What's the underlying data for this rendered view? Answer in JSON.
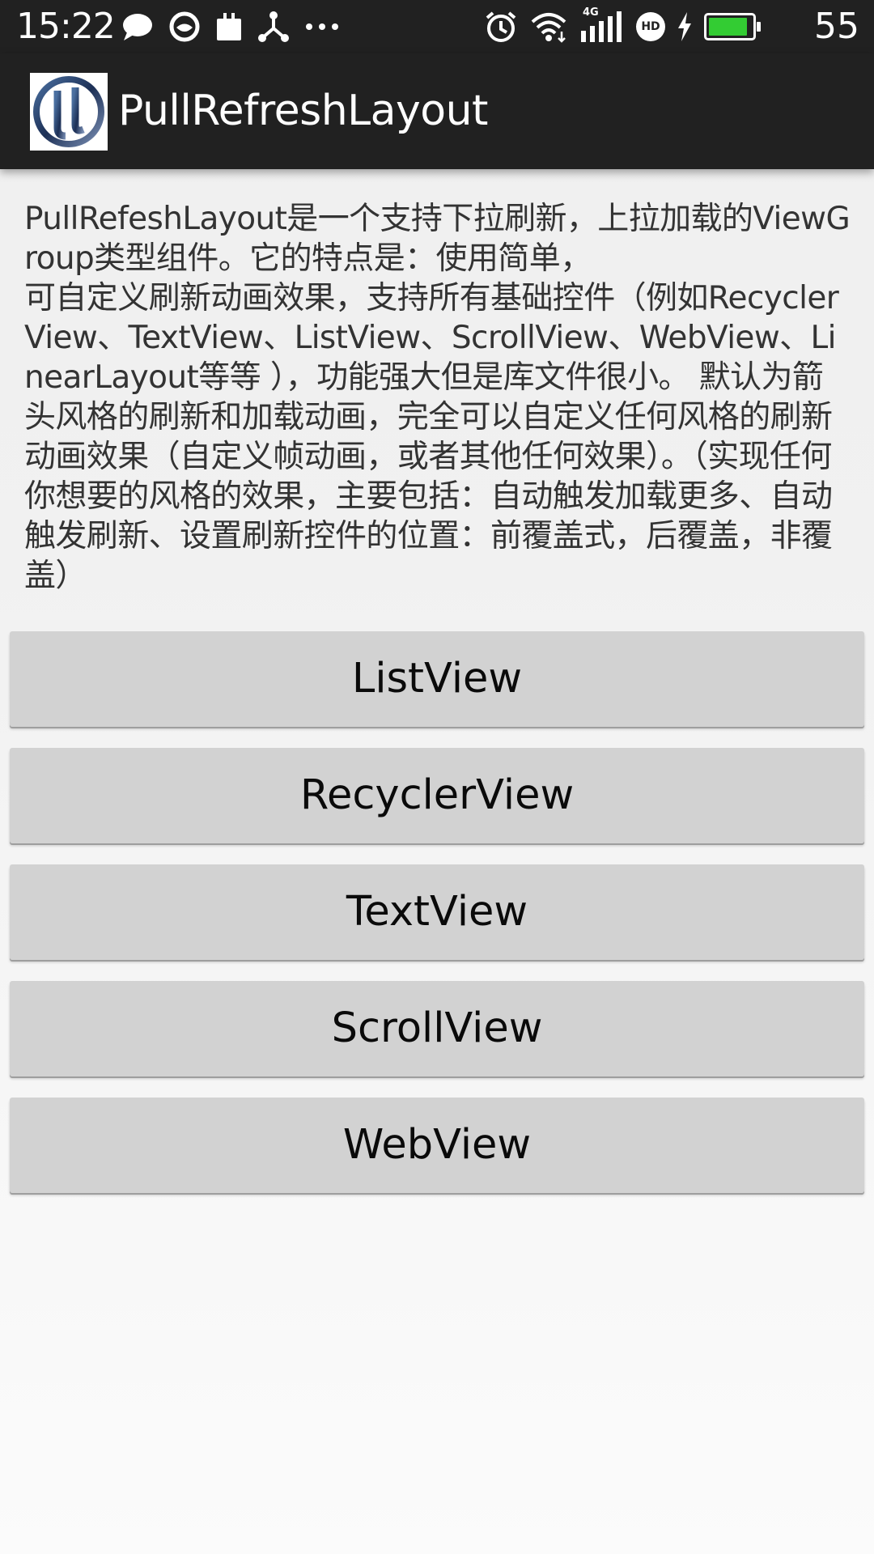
{
  "status_bar": {
    "time": "15:22",
    "left_icons": [
      "chat-bubble-icon",
      "smiley-icon",
      "briefcase-icon",
      "share-network-icon",
      "more-dots-icon"
    ],
    "right_icons": [
      "alarm-icon",
      "wifi-icon",
      "signal-4g-icon",
      "hd-icon",
      "charging-icon",
      "battery-icon"
    ],
    "network_label": "4G",
    "hd_label": "HD",
    "battery_level": "55",
    "battery_fill_color": "#33cc33"
  },
  "app_bar": {
    "title": "PullRefreshLayout",
    "background_color": "#212121"
  },
  "description": "PullRefeshLayout是一个支持下拉刷新，上拉加载的ViewGroup类型组件。它的特点是：使用简单，\n可自定义刷新动画效果，支持所有基础控件（例如RecyclerView、TextView、ListView、ScrollView、WebView、LinearLayout等等 ），功能强大但是库文件很小。 默认为箭头风格的刷新和加载动画，完全可以自定义任何风格的刷新动画效果（自定义帧动画，或者其他任何效果）。（实现任何你想要的风格的效果，主要包括：自动触发加载更多、自动触发刷新、设置刷新控件的位置：前覆盖式，后覆盖，非覆盖）",
  "buttons": [
    {
      "label": "ListView"
    },
    {
      "label": "RecyclerView"
    },
    {
      "label": "TextView"
    },
    {
      "label": "ScrollView"
    },
    {
      "label": "WebView"
    }
  ]
}
